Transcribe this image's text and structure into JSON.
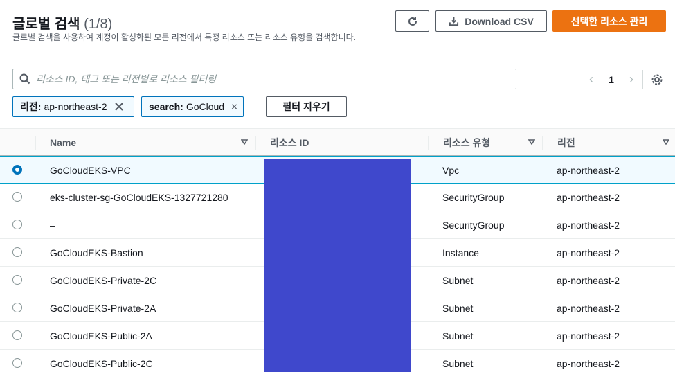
{
  "header": {
    "title": "글로벌 검색",
    "count": "(1/8)",
    "subtitle": "글로벌 검색을 사용하여 계정이 활성화된 모든 리전에서 특정 리소스 또는 리소스 유형을 검색합니다."
  },
  "toolbar": {
    "download_label": "Download CSV",
    "manage_label": "선택한 리소스 관리"
  },
  "search": {
    "placeholder": "리소스 ID, 태그 또는 리전별로 리소스 필터링",
    "value": ""
  },
  "pagination": {
    "prev": "‹",
    "page": "1",
    "next": "›"
  },
  "filters": [
    {
      "key": "리전:",
      "value": "ap-northeast-2"
    },
    {
      "key": "search:",
      "value": "GoCloud"
    }
  ],
  "clear_filters_label": "필터 지우기",
  "table": {
    "columns": [
      "Name",
      "리소스 ID",
      "리소스 유형",
      "리전"
    ],
    "rows": [
      {
        "name": "GoCloudEKS-VPC",
        "type": "Vpc",
        "region": "ap-northeast-2",
        "selected": true
      },
      {
        "name": "eks-cluster-sg-GoCloudEKS-1327721280",
        "type": "SecurityGroup",
        "region": "ap-northeast-2",
        "selected": false
      },
      {
        "name": "–",
        "type": "SecurityGroup",
        "region": "ap-northeast-2",
        "selected": false
      },
      {
        "name": "GoCloudEKS-Bastion",
        "type": "Instance",
        "region": "ap-northeast-2",
        "selected": false
      },
      {
        "name": "GoCloudEKS-Private-2C",
        "type": "Subnet",
        "region": "ap-northeast-2",
        "selected": false
      },
      {
        "name": "GoCloudEKS-Private-2A",
        "type": "Subnet",
        "region": "ap-northeast-2",
        "selected": false
      },
      {
        "name": "GoCloudEKS-Public-2A",
        "type": "Subnet",
        "region": "ap-northeast-2",
        "selected": false
      },
      {
        "name": "GoCloudEKS-Public-2C",
        "type": "Subnet",
        "region": "ap-northeast-2",
        "selected": false
      }
    ]
  },
  "colors": {
    "primary": "#ec7211",
    "accent": "#0073bb",
    "redaction": "#3f48cc"
  },
  "icons": [
    "refresh-icon",
    "download-icon",
    "search-icon",
    "chevron-left-icon",
    "chevron-right-icon",
    "settings-gear-icon",
    "close-icon",
    "sort-caret-icon",
    "radio-icon"
  ]
}
